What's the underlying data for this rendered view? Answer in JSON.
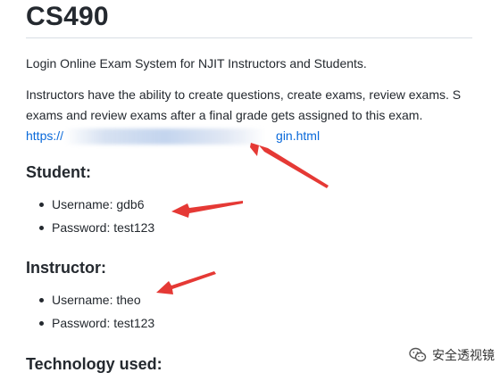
{
  "title": "CS490",
  "intro": "Login Online Exam System for NJIT Instructors and Students.",
  "description_line1": "Instructors have the ability to create questions, create exams, review exams. S",
  "description_line2": "exams and review exams after a final grade gets assigned to this exam.",
  "link_prefix": "https://",
  "link_suffix": "gin.html",
  "student": {
    "heading": "Student:",
    "items": [
      "Username: gdb6",
      "Password: test123"
    ]
  },
  "instructor": {
    "heading": "Instructor:",
    "items": [
      "Username: theo",
      "Password: test123"
    ]
  },
  "technology": {
    "heading": "Technology used:"
  },
  "watermark": {
    "text": "安全透视镜",
    "icon": "wechat-logo-icon"
  },
  "colors": {
    "link": "#0969da",
    "arrow": "#e53935",
    "text": "#24292f"
  }
}
